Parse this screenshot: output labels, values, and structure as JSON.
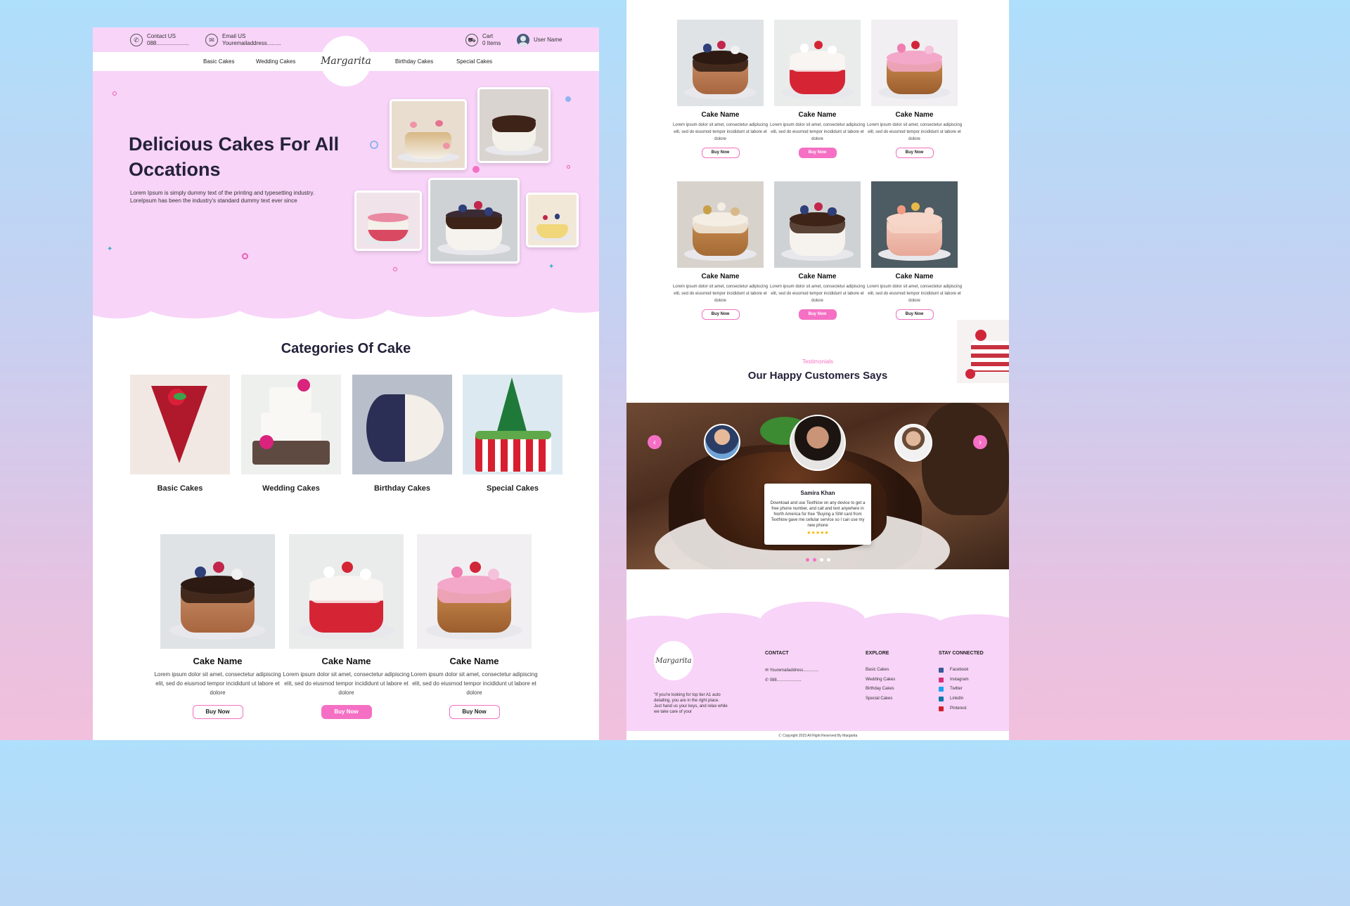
{
  "header": {
    "contact_label": "Contact US",
    "contact_value": "088.....................",
    "email_label": "Email US",
    "email_value": "Youremailaddress.........",
    "cart_label": "Cart",
    "cart_value": "0 Items",
    "user_name": "User Name",
    "logo": "Margarita"
  },
  "nav": {
    "items": [
      "Basic Cakes",
      "Wedding Cakes",
      "Birthday Cakes",
      "Special Cakes"
    ]
  },
  "hero": {
    "title": "Delicious Cakes For All Occations",
    "text": "Lorem Ipsum is simply dummy text of the printing and typesetting industry. LoreIpsum has been the industry's standard dummy text ever since"
  },
  "categories": {
    "title": "Categories Of Cake",
    "items": [
      "Basic Cakes",
      "Wedding Cakes",
      "Birthday Cakes",
      "Special Cakes"
    ]
  },
  "products": {
    "name": "Cake Name",
    "desc": "Lorem ipsum dolor sit amet, consectetur adipiscing elit, sed do eiusmod tempor incididunt ut labore et dolore",
    "buy": "Buy Now"
  },
  "testimonials": {
    "eyebrow": "Testimonials",
    "title": "Our Happy Customers Says",
    "name": "Samira Khan",
    "text": "Download and use TextNow on any device to get a free phone number, and call and text anywhere in North America for free \"Buying a SIM card from TextNow gave me cellular service so I can use my new phone",
    "stars": "★★★★★",
    "prev_icon": "‹",
    "next_icon": "›"
  },
  "footer": {
    "logo": "Margarita",
    "quote": "\"If you're looking for top tier A1 auto detailing, you are in the right place. Just hand us your keys, and relax while we take care of your",
    "contact_head": "CONTACT",
    "email": "Youremailaddress.............",
    "phone": "088.....................",
    "explore_head": "EXPLORE",
    "explore": [
      "Basic Cakes",
      "Wedding Cakes",
      "Birthday Cakes",
      "Special Cakes"
    ],
    "social_head": "STAY CONNECTED",
    "social": [
      "Facebook",
      "Instagram",
      "Twitter",
      "LinkdIn",
      "Pinterest"
    ],
    "copyright": "Copyright 2023 All Right Reserved By Margarita"
  },
  "colors": {
    "accent_pink": "#f570c4",
    "hero_pink": "#f8d4f8",
    "dark_text": "#24223a"
  }
}
